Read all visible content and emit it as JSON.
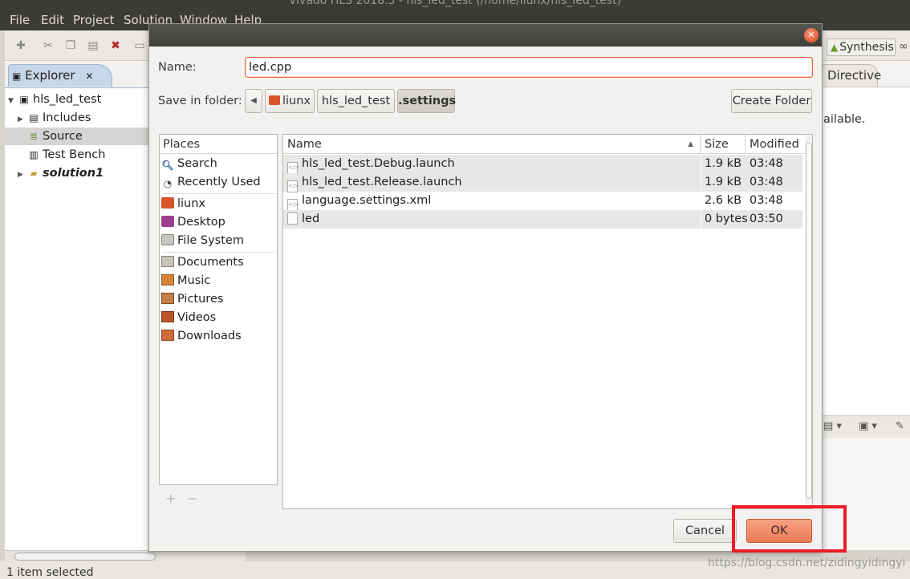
{
  "ide": {
    "title": "Vivado HLS 2018.3 - hls_led_test (/home/liunx/hls_led_test)",
    "menu": [
      "File",
      "Edit",
      "Project",
      "Solution",
      "Window",
      "Help"
    ],
    "synthesis_label": "Synthesis",
    "explorer_tab": "Explorer",
    "tree": [
      {
        "label": "hls_led_test",
        "icon": "project-icon"
      },
      {
        "label": "Includes",
        "icon": "includes-icon"
      },
      {
        "label": "Source",
        "icon": "source-icon"
      },
      {
        "label": "Test Bench",
        "icon": "testbench-icon"
      },
      {
        "label": "solution1",
        "icon": "solution-folder-icon"
      }
    ],
    "directive_tab": "Directive",
    "available_text": "ailable.",
    "status_text": "1 item selected",
    "watermark": "https://blog.csdn.net/zidingyidingyi"
  },
  "dialog": {
    "name_label": "Name:",
    "name_value": "led.cpp",
    "folder_label": "Save in folder:",
    "breadcrumbs": [
      "liunx",
      "hls_led_test",
      ".settings"
    ],
    "create_folder": "Create Folder",
    "places_header": "Places",
    "places": [
      {
        "label": "Search",
        "icon": "search-icon"
      },
      {
        "label": "Recently Used",
        "icon": "recent-icon"
      },
      {
        "label": "liunx",
        "icon": "home-folder-icon"
      },
      {
        "label": "Desktop",
        "icon": "desktop-icon"
      },
      {
        "label": "File System",
        "icon": "filesystem-icon"
      },
      {
        "label": "Documents",
        "icon": "documents-icon"
      },
      {
        "label": "Music",
        "icon": "music-icon"
      },
      {
        "label": "Pictures",
        "icon": "pictures-icon"
      },
      {
        "label": "Videos",
        "icon": "videos-icon"
      },
      {
        "label": "Downloads",
        "icon": "downloads-icon"
      }
    ],
    "columns": {
      "name": "Name",
      "size": "Size",
      "modified": "Modified"
    },
    "files": [
      {
        "name": "hls_led_test.Debug.launch",
        "size": "1.9 kB",
        "modified": "03:48"
      },
      {
        "name": "hls_led_test.Release.launch",
        "size": "1.9 kB",
        "modified": "03:48"
      },
      {
        "name": "language.settings.xml",
        "size": "2.6 kB",
        "modified": "03:48"
      },
      {
        "name": "led",
        "size": "0 bytes",
        "modified": "03:50"
      }
    ],
    "cancel": "Cancel",
    "ok": "OK"
  },
  "colors": {
    "accent": "#ed7a55",
    "highlight": "#ee1b24"
  }
}
